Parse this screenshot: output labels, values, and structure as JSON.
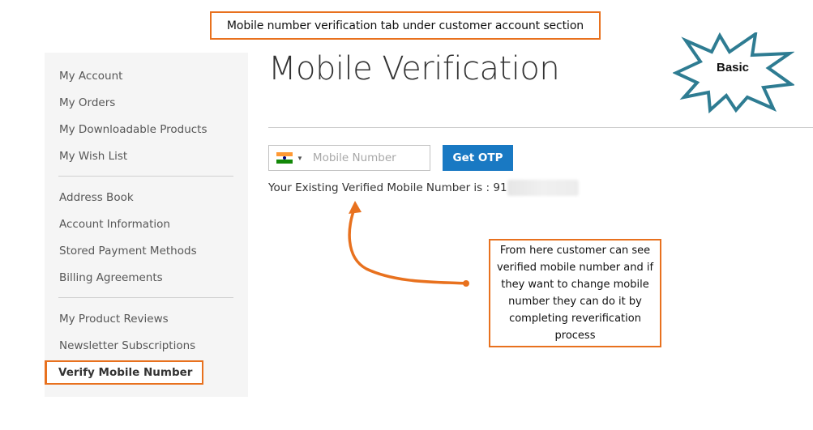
{
  "top_callout": {
    "text": "Mobile number verification tab under customer account section"
  },
  "badge": {
    "label": "Basic"
  },
  "sidebar": {
    "groups": [
      [
        "My Account",
        "My Orders",
        "My Downloadable Products",
        "My Wish List"
      ],
      [
        "Address Book",
        "Account Information",
        "Stored Payment Methods",
        "Billing Agreements"
      ],
      [
        "My Product Reviews",
        "Newsletter Subscriptions"
      ]
    ],
    "active_item": "Verify Mobile Number"
  },
  "main": {
    "title": "Mobile Verification",
    "phone_input": {
      "placeholder": "Mobile Number",
      "value": ""
    },
    "get_otp_label": "Get OTP",
    "existing_text": "Your Existing Verified Mobile Number is : 91"
  },
  "note_callout": {
    "text": "From here customer can see verified mobile number and if they want to change mobile number they can do it by completing reverification process"
  },
  "colors": {
    "accent_orange": "#e8711e",
    "button_blue": "#1979c3",
    "badge_teal": "#2e7c92"
  }
}
